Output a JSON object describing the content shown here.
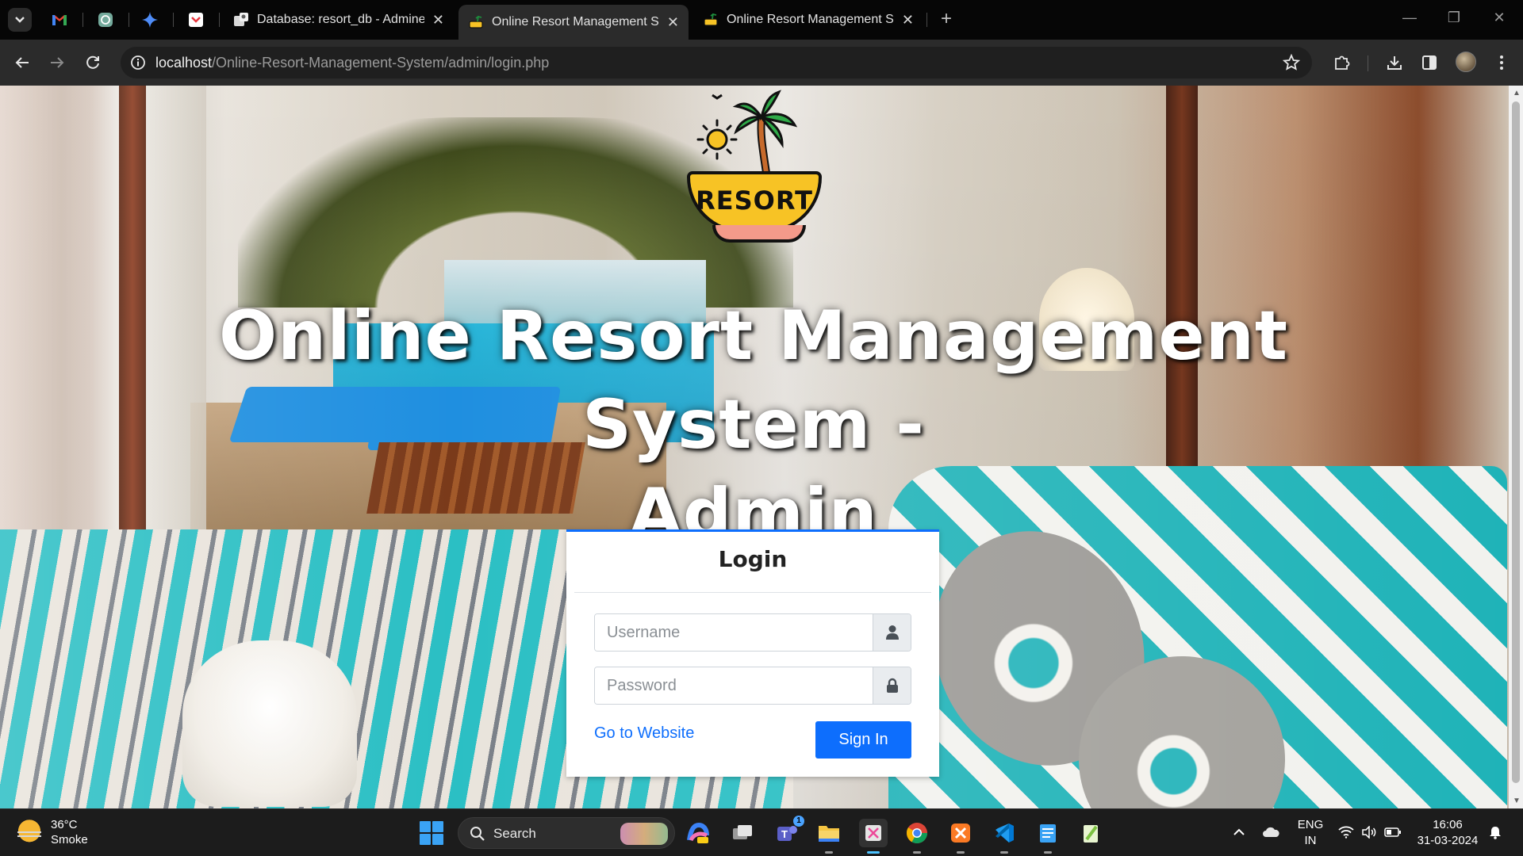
{
  "browser": {
    "tabs": [
      {
        "title": "Database: resort_db - Adminer",
        "active": false
      },
      {
        "title": "Online Resort Management System",
        "active": true
      },
      {
        "title": "Online Resort Management System",
        "active": false
      }
    ],
    "url_host": "localhost",
    "url_path": "/Online-Resort-Management-System/admin/login.php",
    "new_tab_label": "+"
  },
  "logo": {
    "text": "RESORT"
  },
  "page": {
    "headline_line1": "Online Resort Management System -",
    "headline_line2": "Admin"
  },
  "login": {
    "title": "Login",
    "username_placeholder": "Username",
    "password_placeholder": "Password",
    "username_value": "",
    "password_value": "",
    "website_link": "Go to Website",
    "signin_label": "Sign In"
  },
  "taskbar": {
    "weather_temp": "36°C",
    "weather_desc": "Smoke",
    "search_label": "Search",
    "teams_badge": "1",
    "language_line1": "ENG",
    "language_line2": "IN",
    "time": "16:06",
    "date": "31-03-2024"
  },
  "colors": {
    "accent": "#0d6efd",
    "tab_bar": "#060606",
    "toolbar": "#2b2b2b",
    "taskbar": "#1c1c1c"
  },
  "icons": [
    "tab-search-icon",
    "gmail-icon",
    "chatgpt-icon",
    "gemini-icon",
    "pocket-icon",
    "back-icon",
    "forward-icon",
    "reload-icon",
    "site-info-icon",
    "bookmark-star-icon",
    "extensions-icon",
    "downloads-icon",
    "side-panel-icon",
    "menu-icon",
    "user-icon",
    "lock-icon",
    "windows-start-icon",
    "search-icon",
    "wifi-icon",
    "volume-icon",
    "battery-icon",
    "bell-icon"
  ]
}
